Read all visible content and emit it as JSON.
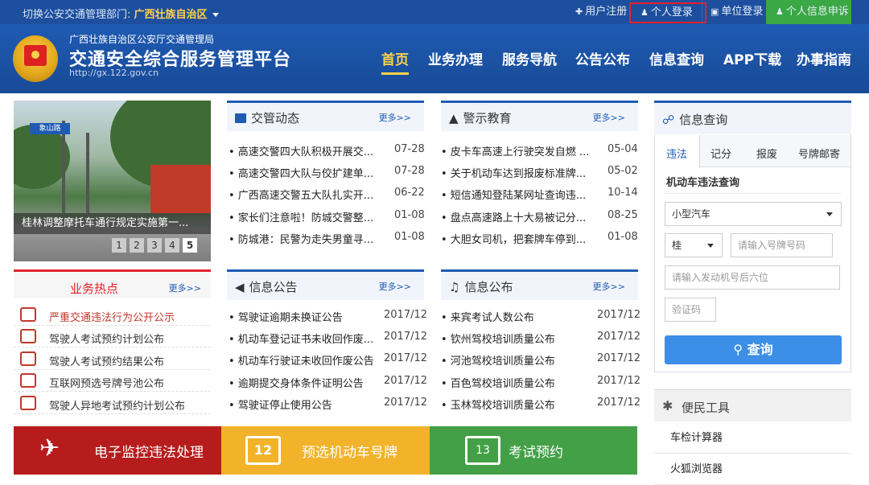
{
  "topbar": {
    "switch_label": "切换公安交通管理部门:",
    "region": "广西壮族自治区",
    "user_register": "用户注册",
    "personal_login": "个人登录",
    "unit_login": "单位登录",
    "personal_info_apply": "个人信息申诉"
  },
  "header": {
    "org": "广西壮族自治区公安厅交通管理局",
    "title": "交通安全综合服务管理平台",
    "url": "http://gx.122.gov.cn",
    "nav": [
      "首页",
      "业务办理",
      "服务导航",
      "公告公布",
      "信息查询",
      "APP下载",
      "办事指南"
    ]
  },
  "slider": {
    "caption": "桂林调整摩托车通行规定实施第一...",
    "pages": [
      "1",
      "2",
      "3",
      "4",
      "5"
    ],
    "sign_text": "象山路"
  },
  "news": {
    "title": "交管动态",
    "more": "更多>>",
    "items": [
      {
        "t": "• 高速交警四大队积极开展交...",
        "d": "07-28"
      },
      {
        "t": "• 高速交警四大队与佼扩建单...",
        "d": "07-28"
      },
      {
        "t": "• 广西高速交警五大队扎实开...",
        "d": "06-22"
      },
      {
        "t": "• 家长们注意啦！防城交警整...",
        "d": "01-08"
      },
      {
        "t": "• 防城港：民警为走失男童寻...",
        "d": "01-08"
      }
    ]
  },
  "warning": {
    "title": "警示教育",
    "more": "更多>>",
    "items": [
      {
        "t": "• 皮卡车高速上行驶突发自燃 ...",
        "d": "05-04"
      },
      {
        "t": "• 关于机动车达到报废标准牌...",
        "d": "05-02"
      },
      {
        "t": "• 短信通知登陆某网址查询违...",
        "d": "10-14"
      },
      {
        "t": "• 盘点高速路上十大易被记分...",
        "d": "08-25"
      },
      {
        "t": "• 大胆女司机，把套牌车停到...",
        "d": "01-08"
      }
    ]
  },
  "hot": {
    "title": "业务热点",
    "more": "更多>>",
    "items": [
      "严重交通违法行为公开公示",
      "驾驶人考试预约计划公布",
      "驾驶人考试预约结果公布",
      "互联网预选号牌号池公布",
      "驾驶人异地考试预约计划公布"
    ]
  },
  "notice": {
    "title": "信息公告",
    "more": "更多>>",
    "items": [
      {
        "t": "• 驾驶证逾期未换证公告",
        "d": "2017/12"
      },
      {
        "t": "• 机动车登记证书未收回作废...",
        "d": "2017/12"
      },
      {
        "t": "• 机动车行驶证未收回作废公告",
        "d": "2017/12"
      },
      {
        "t": "• 逾期提交身体条件证明公告",
        "d": "2017/12"
      },
      {
        "t": "• 驾驶证停止使用公告",
        "d": "2017/12"
      }
    ]
  },
  "publish": {
    "title": "信息公布",
    "more": "更多>>",
    "items": [
      {
        "t": "• 来宾考试人数公布",
        "d": "2017/12"
      },
      {
        "t": "• 钦州驾校培训质量公布",
        "d": "2017/12"
      },
      {
        "t": "• 河池驾校培训质量公布",
        "d": "2017/12"
      },
      {
        "t": "• 百色驾校培训质量公布",
        "d": "2017/12"
      },
      {
        "t": "• 玉林驾校培训质量公布",
        "d": "2017/12"
      }
    ]
  },
  "tiles": {
    "e_monitor": "电子监控违法处理",
    "plate_select": "预选机动车号牌",
    "exam_booking": "考试预约",
    "plate_icon_text": "12",
    "calendar_icon_text": "13"
  },
  "query": {
    "title": "信息查询",
    "tabs": [
      "违法",
      "记分",
      "报废",
      "号牌邮寄"
    ],
    "subtitle": "机动车违法查询",
    "vehicle_type": "小型汽车",
    "province": "桂",
    "plate_placeholder": "请输入号牌号码",
    "engine_placeholder": "请输入发动机号后六位",
    "captcha_placeholder": "验证码",
    "button": "查询"
  },
  "tools": {
    "title": "便民工具",
    "items": [
      "车检计算器",
      "火狐浏览器"
    ]
  },
  "colors": {
    "brand_blue": "#1d4f9e",
    "accent_yellow": "#ffd24a",
    "tile_red": "#b71c1c",
    "tile_yellow": "#f2b32a",
    "tile_green": "#43a047",
    "highlight_red": "#e5212b"
  }
}
